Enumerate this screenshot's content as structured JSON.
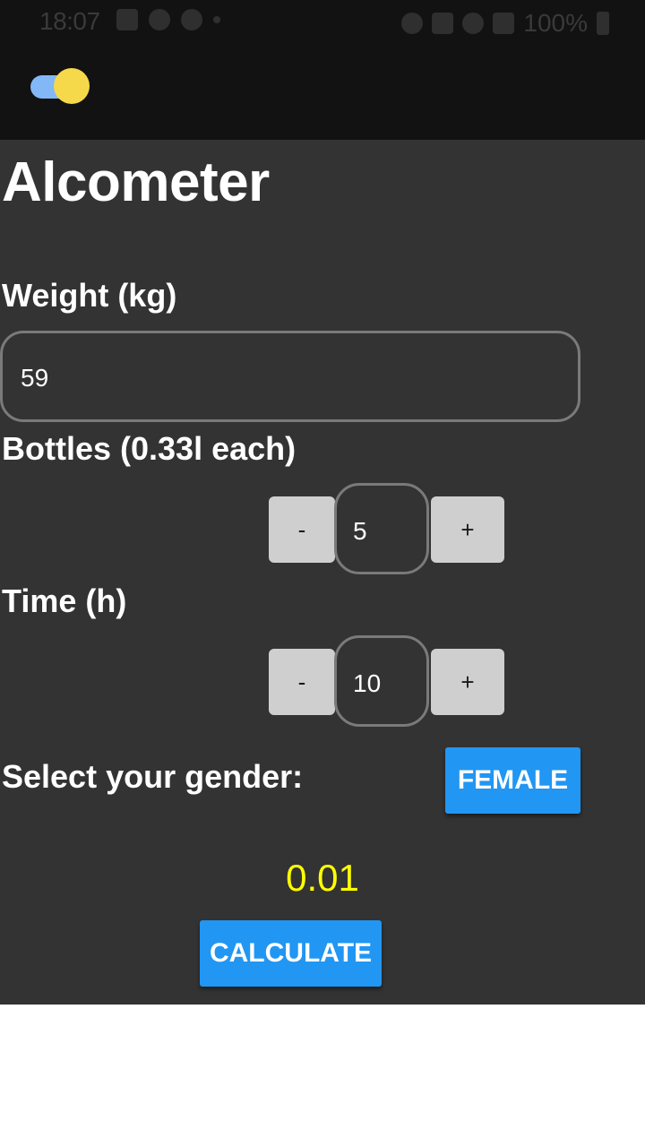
{
  "status_bar": {
    "time": "18:07",
    "left_icons": [
      "gallery-icon",
      "a-badge-icon",
      "cloud-off-icon",
      "dot-icon"
    ],
    "right_icons": [
      "alarm-icon",
      "mute-icon",
      "wifi-icon",
      "signal-icon"
    ],
    "battery": "100%"
  },
  "app_bar": {
    "theme_toggle": {
      "state": "on",
      "track_color": "#82b8f5",
      "knob_color": "#f6d94a"
    }
  },
  "main": {
    "title": "Alcometer",
    "weight": {
      "label": "Weight (kg)",
      "value": "59"
    },
    "bottles": {
      "label": "Bottles (0.33l each)",
      "minus": "-",
      "value": "5",
      "plus": "+"
    },
    "time": {
      "label": "Time (h)",
      "minus": "-",
      "value": "10",
      "plus": "+"
    },
    "gender": {
      "label": "Select your gender:",
      "button": "FEMALE"
    },
    "result": "0.01",
    "calculate_button": "CALCULATE"
  },
  "colors": {
    "background": "#333333",
    "accent": "#2196f3",
    "result": "#ffff00"
  }
}
